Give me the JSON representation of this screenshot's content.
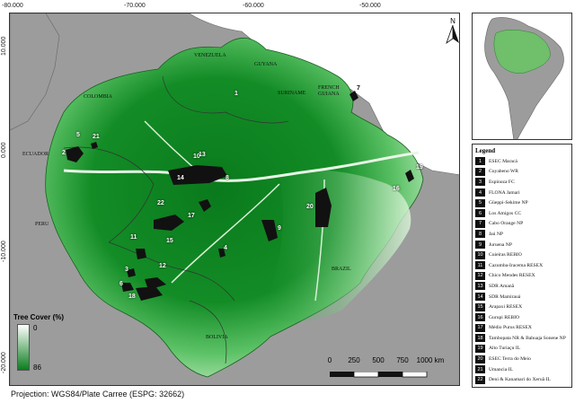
{
  "axes": {
    "lon_ticks": [
      "-80.000",
      "-70.000",
      "-60.000",
      "-50.000"
    ],
    "lat_ticks": [
      "10.000",
      "0.000",
      "-10.000",
      "-20.000"
    ]
  },
  "countries": {
    "venezuela": "VENEZUELA",
    "guyana": "GUYANA",
    "suriname": "SURINAME",
    "french_guiana": "FRENCH GUIANA",
    "colombia": "COLOMBIA",
    "ecuador": "ECUADOR",
    "peru": "PERU",
    "brazil": "BRAZIL",
    "bolivia": "BOLIVIA"
  },
  "north_arrow": "N",
  "tree_cover": {
    "title": "Tree Cover (%)",
    "min": "0",
    "max": "86",
    "color_low": "#ffffff",
    "color_high": "#0b7d1e"
  },
  "scale_bar": {
    "labels": [
      "0",
      "250",
      "500",
      "750",
      "1000 km"
    ]
  },
  "legend": {
    "title": "Legend",
    "items": [
      {
        "num": "1",
        "label": "ESEC Maracá"
      },
      {
        "num": "2",
        "label": "Cuyabeno WR"
      },
      {
        "num": "3",
        "label": "Espinoza FC"
      },
      {
        "num": "4",
        "label": "FLONA Jamari"
      },
      {
        "num": "5",
        "label": "Güeppi-Sekime NP"
      },
      {
        "num": "6",
        "label": "Los Amigos CC"
      },
      {
        "num": "7",
        "label": "Cabo Orange NP"
      },
      {
        "num": "8",
        "label": "Jaú NP"
      },
      {
        "num": "9",
        "label": "Juruena NP"
      },
      {
        "num": "10",
        "label": "Cuieiras REBIO"
      },
      {
        "num": "11",
        "label": "Cazumba-Iracema RESEX"
      },
      {
        "num": "12",
        "label": "Chico Mendes RESEX"
      },
      {
        "num": "13",
        "label": "SDR Amanã"
      },
      {
        "num": "14",
        "label": "SDR Mamirauá"
      },
      {
        "num": "15",
        "label": "Arapaxi RESEX"
      },
      {
        "num": "16",
        "label": "Gurupi REBIO"
      },
      {
        "num": "17",
        "label": "Médio Purus RESEX"
      },
      {
        "num": "18",
        "label": "Tambopata NR & Bahuaja Sonene NP"
      },
      {
        "num": "19",
        "label": "Alto Turiaçu IL"
      },
      {
        "num": "20",
        "label": "ESEC Terra do Meio"
      },
      {
        "num": "21",
        "label": "Umancia IL"
      },
      {
        "num": "22",
        "label": "Deni & Kanamari do Xeruã IL"
      }
    ]
  },
  "map_numbers": [
    "1",
    "2",
    "3",
    "4",
    "5",
    "6",
    "7",
    "8",
    "9",
    "10",
    "11",
    "12",
    "13",
    "14",
    "15",
    "16",
    "17",
    "18",
    "19",
    "20",
    "21",
    "22"
  ],
  "projection": "Projection: WGS84/Plate Carree (ESPG: 32662)"
}
